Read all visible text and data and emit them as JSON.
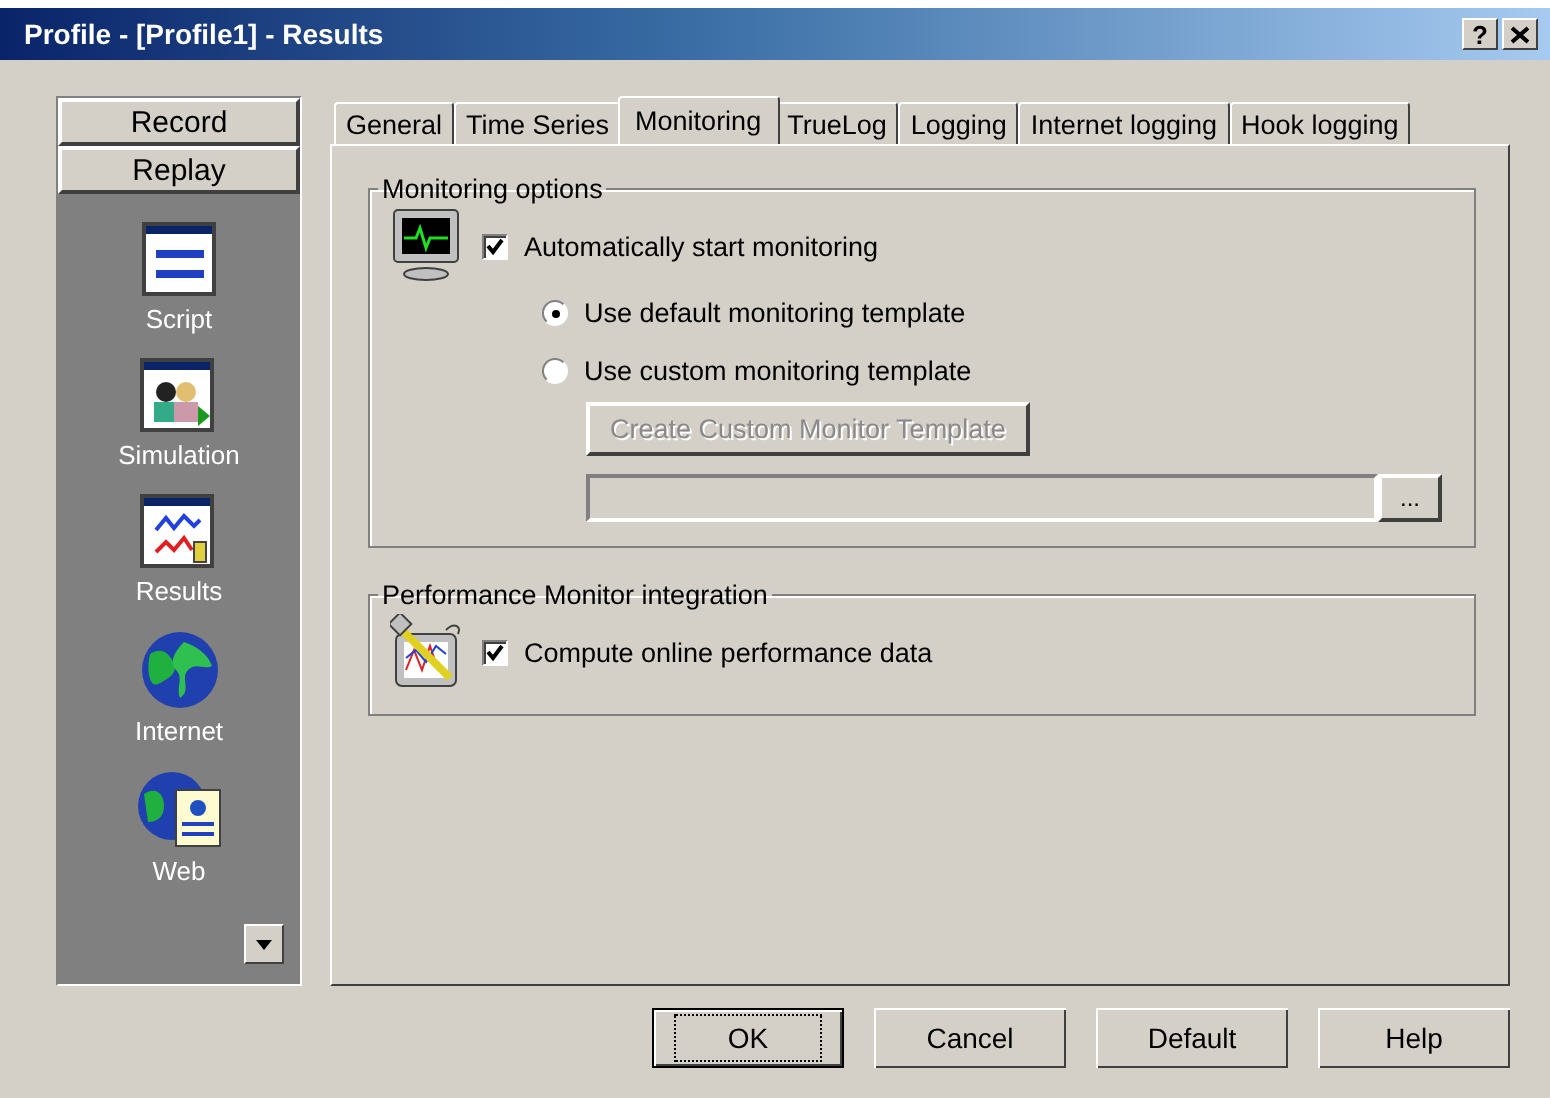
{
  "window": {
    "title": "Profile - [Profile1] - Results",
    "help": "?"
  },
  "sidebar": {
    "groups": [
      {
        "label": "Record"
      },
      {
        "label": "Replay"
      }
    ],
    "items": [
      {
        "label": "Script",
        "kind": "script"
      },
      {
        "label": "Simulation",
        "kind": "simulation"
      },
      {
        "label": "Results",
        "kind": "results"
      },
      {
        "label": "Internet",
        "kind": "internet"
      },
      {
        "label": "Web",
        "kind": "web"
      }
    ]
  },
  "tabs": [
    {
      "label": "General",
      "selected": false
    },
    {
      "label": "Time Series",
      "selected": false
    },
    {
      "label": "Monitoring",
      "selected": true
    },
    {
      "label": "TrueLog",
      "selected": false
    },
    {
      "label": "Logging",
      "selected": false
    },
    {
      "label": "Internet logging",
      "selected": false
    },
    {
      "label": "Hook logging",
      "selected": false
    }
  ],
  "monitoring_options": {
    "title": "Monitoring options",
    "auto_start": {
      "label": "Automatically start monitoring",
      "checked": true
    },
    "templates": [
      {
        "label": "Use default monitoring template",
        "selected": true
      },
      {
        "label": "Use custom monitoring template",
        "selected": false
      }
    ],
    "create_button": {
      "label": "Create Custom Monitor Template",
      "disabled": true
    },
    "browse_button": {
      "label": "..."
    }
  },
  "performance": {
    "title": "Performance Monitor integration",
    "compute": {
      "label": "Compute online performance data",
      "checked": true
    }
  },
  "buttons": [
    {
      "label": "OK",
      "default": true
    },
    {
      "label": "Cancel",
      "default": false
    },
    {
      "label": "Default",
      "default": false
    },
    {
      "label": "Help",
      "default": false
    }
  ]
}
